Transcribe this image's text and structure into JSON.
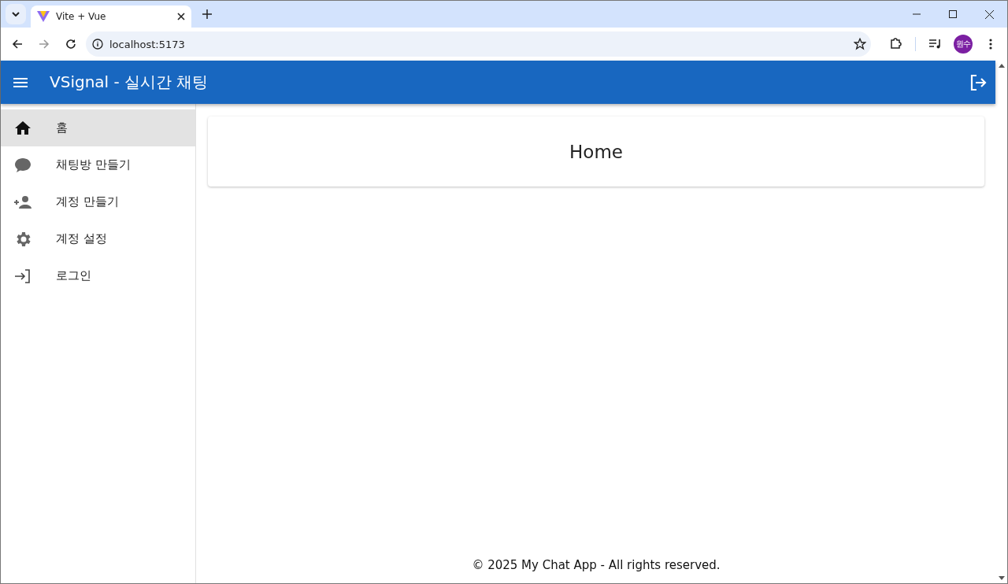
{
  "browser": {
    "tab": {
      "title": "Vite + Vue",
      "selected": true
    },
    "address": "localhost:5173",
    "profile": "원수"
  },
  "app_bar": {
    "title": "VSignal - 실시간 채팅"
  },
  "sidebar": {
    "items": [
      {
        "label": "홈",
        "selected": true
      },
      {
        "label": "채팅방 만들기",
        "selected": false
      },
      {
        "label": "계정 만들기",
        "selected": false
      },
      {
        "label": "계정 설정",
        "selected": false
      },
      {
        "label": "로그인",
        "selected": false
      }
    ]
  },
  "card": {
    "title": "Home"
  },
  "footer": "© 2025 My Chat App - All rights reserved."
}
